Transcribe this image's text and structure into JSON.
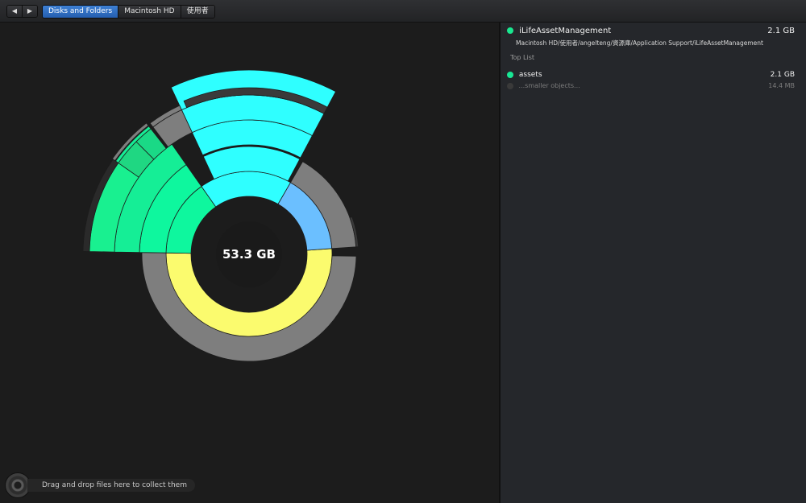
{
  "nav": {
    "back_icon": "◀",
    "forward_icon": "▶"
  },
  "breadcrumb": [
    "Disks and Folders",
    "Macintosh HD",
    "使用者"
  ],
  "sunburst": {
    "center_label": "53.3 GB",
    "colors": {
      "inner": "#18f05a",
      "yellow": "#fbfb6e",
      "cyan": "#2fffff",
      "mint": "#0ef79e",
      "sky": "#6bbfff",
      "grey": "#7e7e7e"
    }
  },
  "details": {
    "name": "iLifeAssetManagement",
    "size": "2.1  GB",
    "path": "Macintosh HD/使用者/angelteng/資源庫/Application Support/iLifeAssetManagement",
    "section_title": "Top List",
    "items": [
      {
        "name": "assets",
        "size": "2.1 GB",
        "color": "#18e895"
      },
      {
        "name": "...smaller objects...",
        "size": "14.4  MB",
        "color": "#3a3a3a"
      }
    ]
  },
  "dropzone": {
    "label": "Drag and drop files here to collect them"
  }
}
